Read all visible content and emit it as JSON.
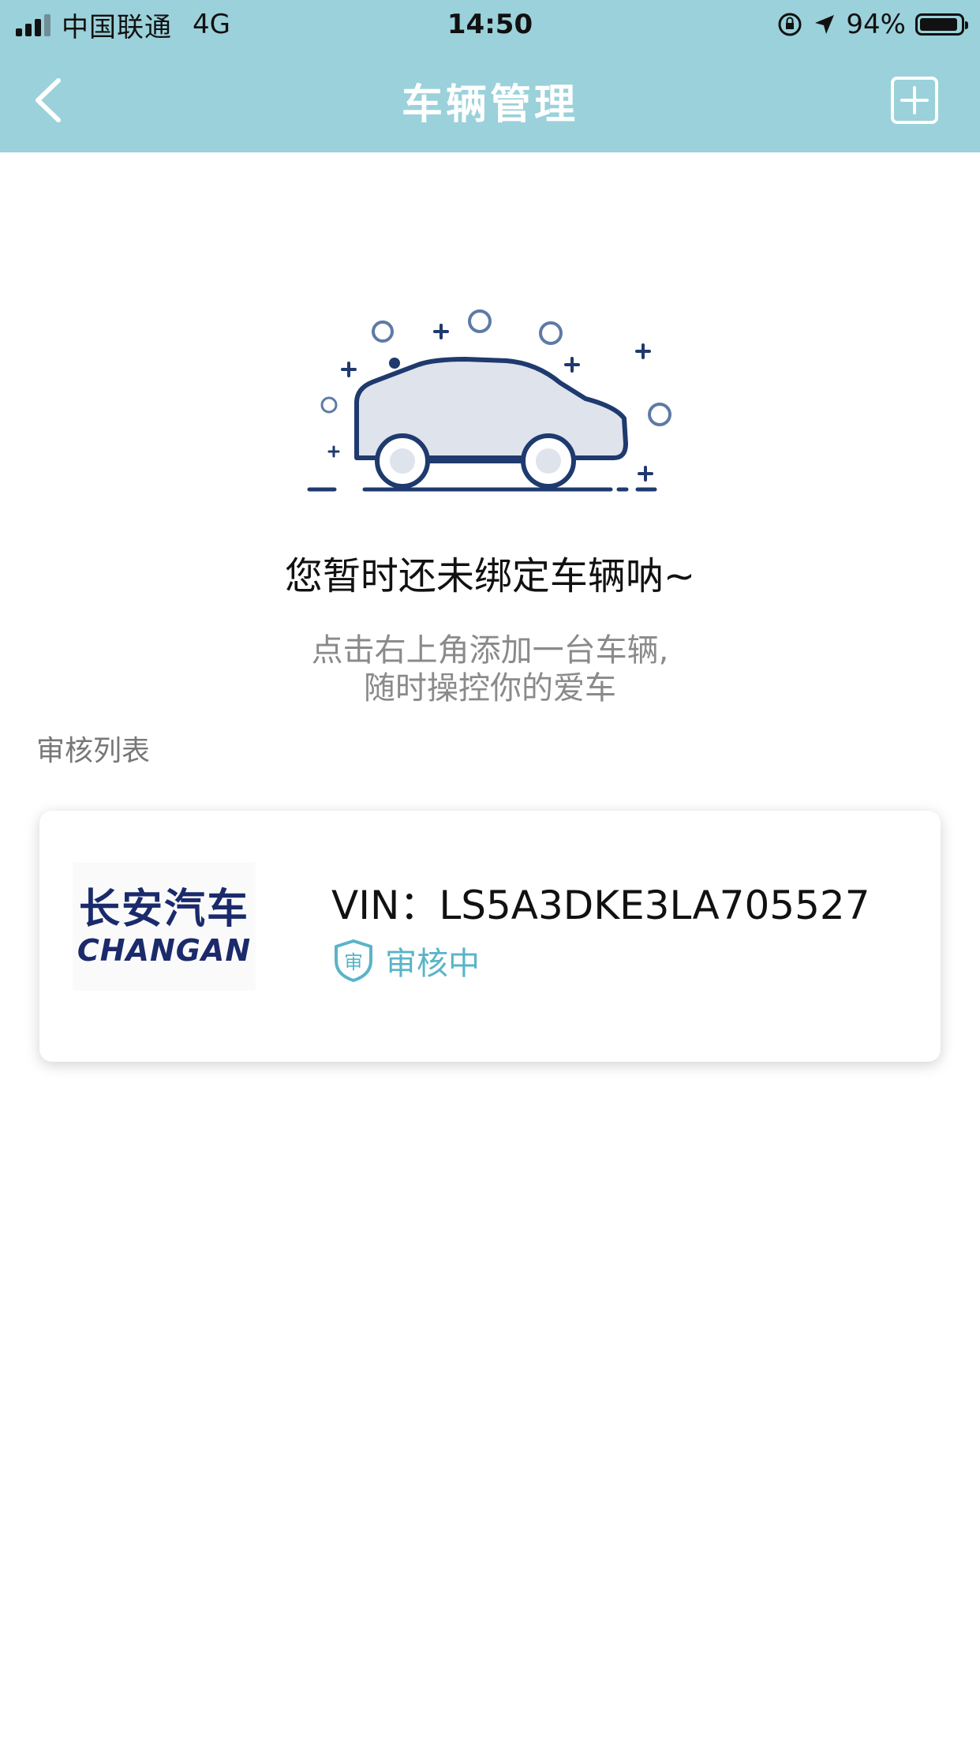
{
  "status_bar": {
    "carrier": "中国联通",
    "network": "4G",
    "time": "14:50",
    "battery": "94%",
    "battery_level": 0.94
  },
  "nav": {
    "title": "车辆管理",
    "back_icon": "chevron-left-icon",
    "add_icon": "plus-square-icon"
  },
  "empty_state": {
    "title": "您暂时还未绑定车辆呐~",
    "subtitle_line1": "点击右上角添加一台车辆,",
    "subtitle_line2": "随时操控你的爱车",
    "illustration_icon": "car-icon"
  },
  "review": {
    "section_label": "审核列表",
    "items": [
      {
        "brand_cn": "长安汽车",
        "brand_en": "CHANGAN",
        "vin": "VIN：LS5A3DKE3LA705527",
        "status": "审核中",
        "status_icon": "shield-icon"
      }
    ]
  },
  "colors": {
    "header_bg": "#9bd1da",
    "status_accent": "#5ab4c8",
    "brand_blue": "#1b2a6b"
  }
}
